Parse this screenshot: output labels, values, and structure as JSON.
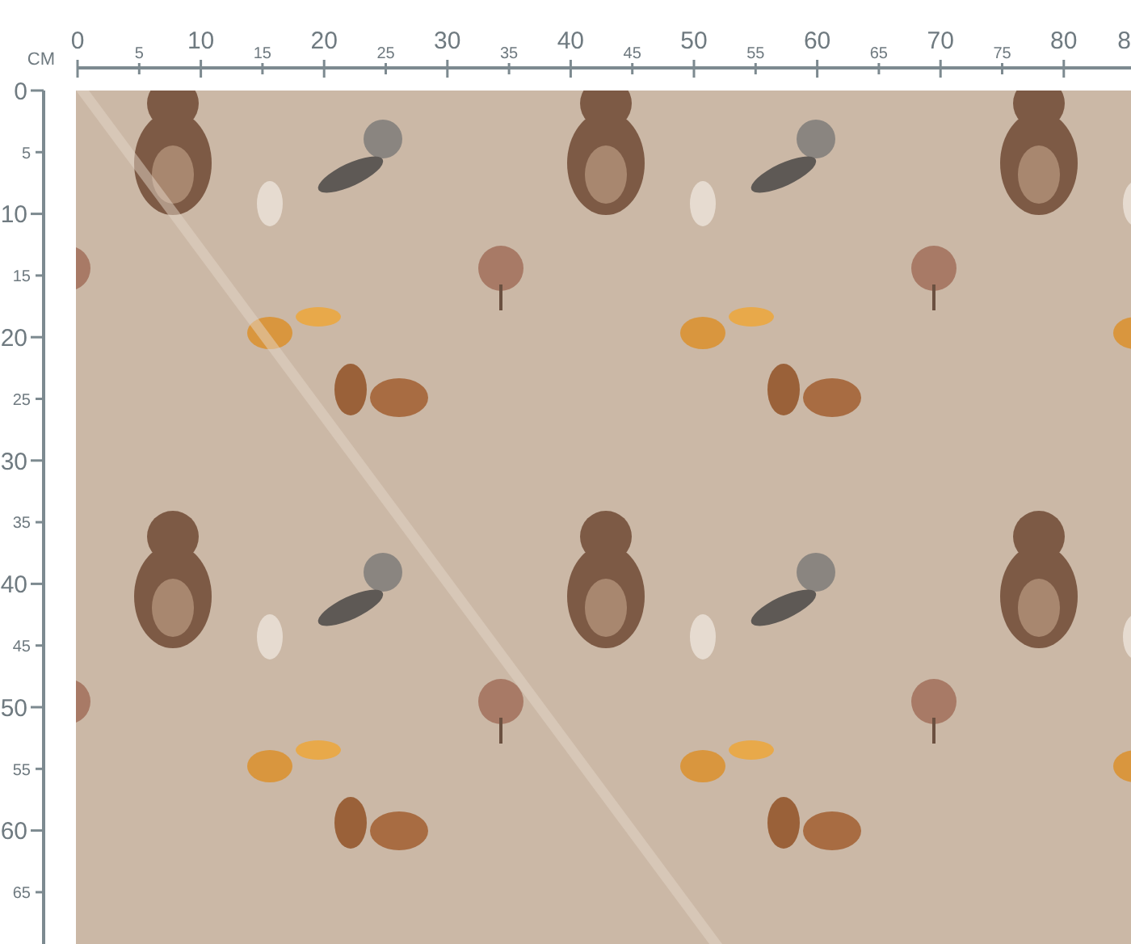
{
  "unit": "CM",
  "top_ruler": {
    "labels": [
      {
        "text": "0",
        "kind": "major"
      },
      {
        "text": "5",
        "kind": "minor"
      },
      {
        "text": "10",
        "kind": "major"
      },
      {
        "text": "15",
        "kind": "minor"
      },
      {
        "text": "20",
        "kind": "major"
      },
      {
        "text": "25",
        "kind": "minor"
      },
      {
        "text": "30",
        "kind": "major"
      },
      {
        "text": "35",
        "kind": "minor"
      },
      {
        "text": "40",
        "kind": "major"
      },
      {
        "text": "45",
        "kind": "minor"
      },
      {
        "text": "50",
        "kind": "major"
      },
      {
        "text": "55",
        "kind": "minor"
      },
      {
        "text": "60",
        "kind": "major"
      },
      {
        "text": "65",
        "kind": "minor"
      },
      {
        "text": "70",
        "kind": "major"
      },
      {
        "text": "75",
        "kind": "minor"
      },
      {
        "text": "80",
        "kind": "major"
      },
      {
        "text": "8",
        "kind": "cut"
      }
    ]
  },
  "side_ruler": {
    "labels": [
      {
        "text": "0",
        "kind": "major"
      },
      {
        "text": "5",
        "kind": "minor"
      },
      {
        "text": "10",
        "kind": "major"
      },
      {
        "text": "15",
        "kind": "minor"
      },
      {
        "text": "20",
        "kind": "major"
      },
      {
        "text": "25",
        "kind": "minor"
      },
      {
        "text": "30",
        "kind": "major"
      },
      {
        "text": "35",
        "kind": "minor"
      },
      {
        "text": "40",
        "kind": "major"
      },
      {
        "text": "45",
        "kind": "minor"
      },
      {
        "text": "50",
        "kind": "major"
      },
      {
        "text": "55",
        "kind": "minor"
      },
      {
        "text": "60",
        "kind": "major"
      },
      {
        "text": "65",
        "kind": "minor"
      }
    ]
  }
}
